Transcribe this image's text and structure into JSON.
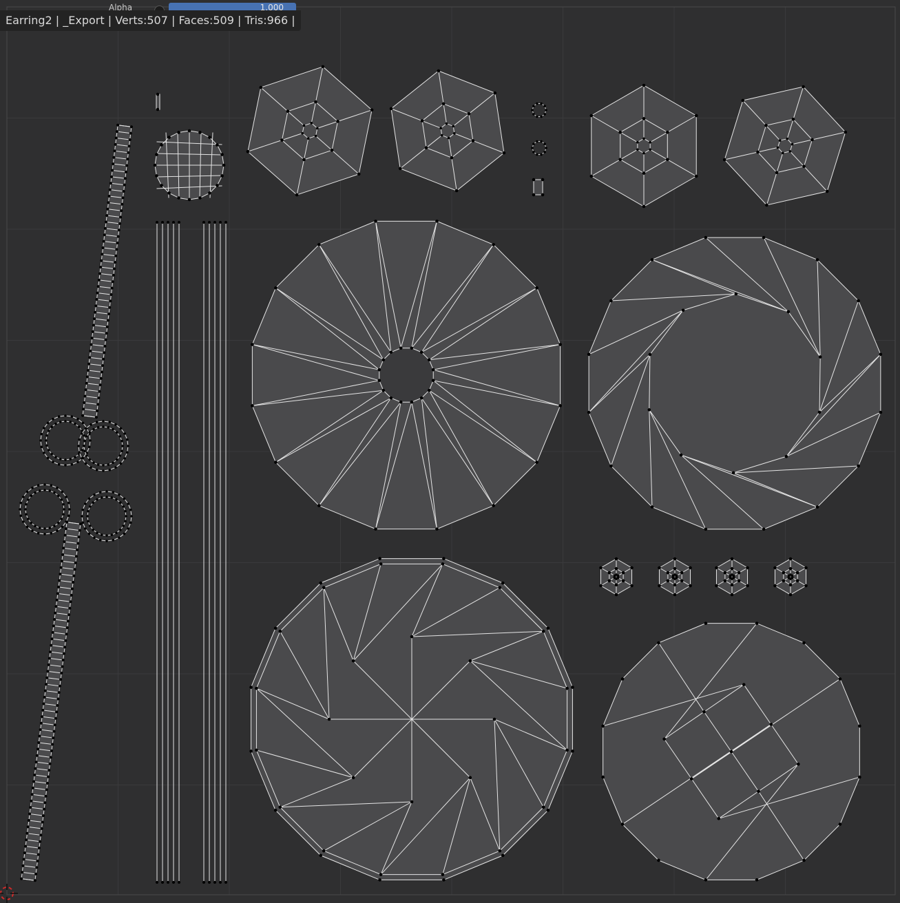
{
  "header": {
    "alpha_label": "Alpha",
    "alpha_value": "1.000",
    "info_text": "Earring2 | _Export | Verts:507 | Faces:509 | Tris:966 |"
  },
  "colors": {
    "background": "#2f2f30",
    "uv_face": "#4a4a4c",
    "uv_edge": "#e6e6e6",
    "uv_vertex": "#000000",
    "grid_line": "#3a3a3c",
    "slider_accent": "#4772b3",
    "cursor_red": "#d22a2a"
  },
  "icons": {
    "cursor": "3d-cursor-icon"
  }
}
